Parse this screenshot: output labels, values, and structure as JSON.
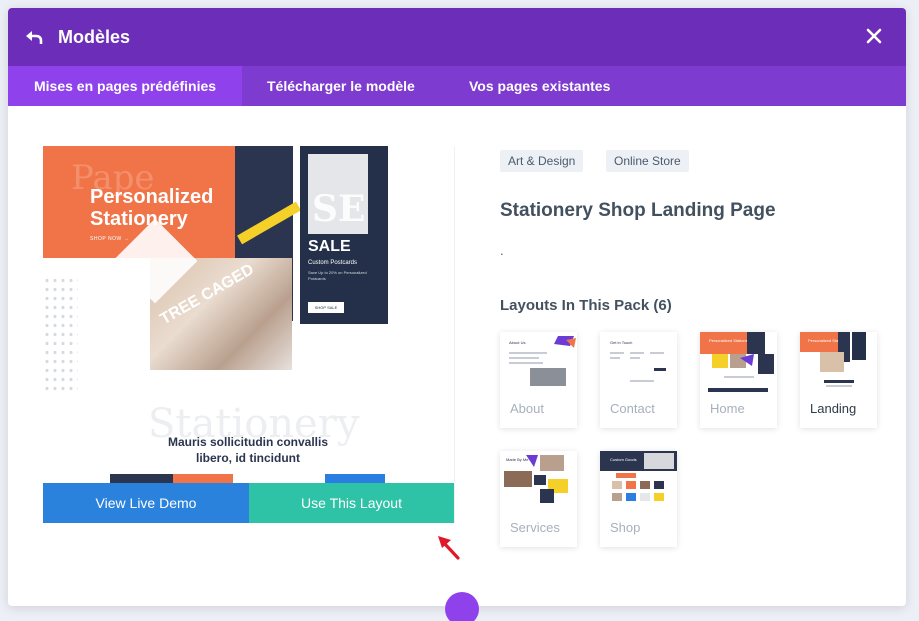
{
  "header": {
    "title": "Modèles",
    "back_icon": "undo-arrow-icon",
    "close_icon": "close-x-icon",
    "background": "#6c2eb9"
  },
  "tabs": [
    {
      "label": "Mises en pages prédéfinies",
      "active": true
    },
    {
      "label": "Télécharger le modèle",
      "active": false
    },
    {
      "label": "Vos pages existantes",
      "active": false
    }
  ],
  "preview": {
    "ghost_text": "Pape",
    "headline_line1": "Personalized",
    "headline_line2": "Stationery",
    "shop_now": "SHOP NOW →",
    "card_logo": "SE",
    "sale": "SALE",
    "custom_postcards": "Custom Postcards",
    "card_small_text": "Save Up to 20% on Personalized Postcards",
    "shop_sale": "SHOP SALE",
    "rotated_text": "TREE CAGED",
    "stationery_watermark": "Stationery",
    "latin_line1": "Mauris sollicitudin convallis",
    "latin_line2": "libero, id tincidunt"
  },
  "buttons": {
    "live_demo": "View Live Demo",
    "use_layout": "Use This Layout"
  },
  "details": {
    "tags": [
      "Art & Design",
      "Online Store"
    ],
    "layout_title": "Stationery Shop Landing Page",
    "description": ".",
    "pack_title": "Layouts In This Pack (6)"
  },
  "thumbnails": [
    {
      "label": "About",
      "active": false,
      "heading": "About Us"
    },
    {
      "label": "Contact",
      "active": false,
      "heading": "Get in Touch"
    },
    {
      "label": "Home",
      "active": false,
      "heading": "Personalized Stationery"
    },
    {
      "label": "Landing",
      "active": true,
      "heading": "Personalized Stationery"
    },
    {
      "label": "Services",
      "active": false,
      "heading": "Made By Me"
    },
    {
      "label": "Shop",
      "active": false,
      "heading": "Custom Goods"
    }
  ],
  "colors": {
    "accent": "#8f42ec",
    "demo_button": "#2a82dc",
    "use_button": "#2ec3a6",
    "annotation_arrow": "#e0192a",
    "brand_orange": "#f07448",
    "brand_navy": "#2b3550"
  }
}
